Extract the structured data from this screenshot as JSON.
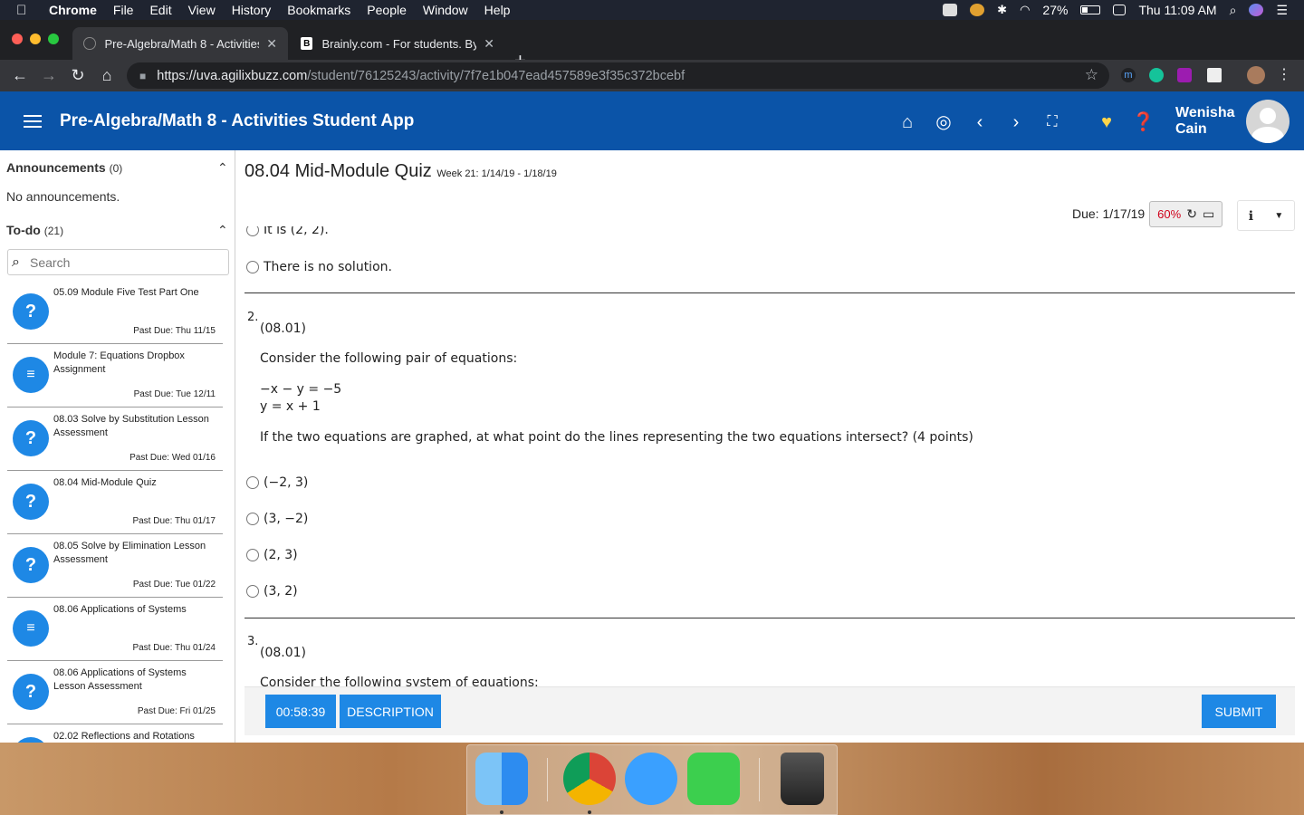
{
  "menubar": {
    "app": "Chrome",
    "menus": [
      "File",
      "Edit",
      "View",
      "History",
      "Bookmarks",
      "People",
      "Window",
      "Help"
    ],
    "battery": "27%",
    "clock": "Thu 11:09 AM"
  },
  "browser": {
    "tabs": [
      {
        "title": "Pre-Algebra/Math 8 - Activities"
      },
      {
        "title": "Brainly.com - For students. By"
      }
    ],
    "url_host": "https://uva.agilixbuzz.com",
    "url_path": "/student/76125243/activity/7f7e1b047ead457589e3f35c372bcebf"
  },
  "app": {
    "title": "Pre-Algebra/Math 8 - Activities Student App",
    "user_first": "Wenisha",
    "user_last": "Cain"
  },
  "sidebar": {
    "announcements_label": "Announcements",
    "announcements_count": "(0)",
    "no_announcements": "No announcements.",
    "todo_label": "To-do",
    "todo_count": "(21)",
    "search_placeholder": "Search",
    "items": [
      {
        "name": "05.09 Module Five Test Part One",
        "due": "Past Due: Thu 11/15",
        "icon": "question-icon"
      },
      {
        "name": "Module 7: Equations Dropbox Assignment",
        "due": "Past Due: Tue 12/11",
        "icon": "document-icon"
      },
      {
        "name": "08.03 Solve by Substitution Lesson Assessment",
        "due": "Past Due: Wed 01/16",
        "icon": "question-icon"
      },
      {
        "name": "08.04 Mid-Module Quiz",
        "due": "Past Due: Thu 01/17",
        "icon": "question-icon"
      },
      {
        "name": "08.05 Solve by Elimination Lesson Assessment",
        "due": "Past Due: Tue 01/22",
        "icon": "question-icon"
      },
      {
        "name": "08.06 Applications of Systems",
        "due": "Past Due: Thu 01/24",
        "icon": "document-icon"
      },
      {
        "name": "08.06 Applications of Systems Lesson Assessment",
        "due": "Past Due: Fri 01/25",
        "icon": "question-icon"
      },
      {
        "name": "02.02 Reflections and Rotations",
        "due": "",
        "icon": "question-icon"
      }
    ]
  },
  "quiz": {
    "title": "08.04 Mid-Module Quiz",
    "week": "Week 21: 1/14/19 - 1/18/19",
    "due": "Due: 1/17/19",
    "score": "60%",
    "partial_option": "It is (2, 2).",
    "prev_option": "There is no solution.",
    "q2": {
      "number": "2.",
      "code": "(08.01)",
      "prompt": "Consider the following pair of equations:",
      "eq1": "−x − y = −5",
      "eq2": "y = x + 1",
      "question": "If the two equations are graphed, at what point do the lines representing the two equations intersect? (4 points)",
      "options": [
        "(−2, 3)",
        "(3, −2)",
        "(2, 3)",
        "(3, 2)"
      ]
    },
    "q3": {
      "number": "3.",
      "code": "(08.01)",
      "prompt": "Consider the following system of equations:"
    },
    "timer": "00:58:39",
    "description_label": "DESCRIPTION",
    "submit_label": "SUBMIT"
  }
}
